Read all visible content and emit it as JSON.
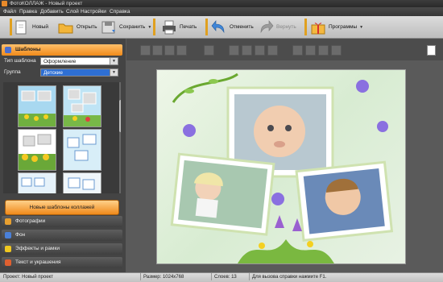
{
  "window": {
    "title": "ФотоКОЛЛАЖ - Новый проект"
  },
  "menu": [
    "Файл",
    "Правка",
    "Добавить",
    "Слой",
    "Настройки",
    "Справка"
  ],
  "toolbar": {
    "new": "Новый",
    "open": "Открыть",
    "save": "Сохранить",
    "print": "Печать",
    "undo": "Отменить",
    "redo": "Вернуть",
    "programs": "Программы"
  },
  "sidebar": {
    "templates_header": "Шаблоны",
    "template_type_label": "Тип шаблона",
    "template_type_value": "Оформление",
    "group_label": "Группа",
    "group_value": "Детские",
    "new_templates_button": "Новые шаблоны коллажей",
    "sections": [
      "Фотографии",
      "Фон",
      "Эффекты и рамки",
      "Текст и украшения"
    ]
  },
  "status": {
    "project": "Проект: Новый проект",
    "size": "Размер: 1024x768",
    "layers": "Слоев: 13",
    "help": "Для вызова справки нажмите F1."
  },
  "colors": {
    "accent": "#f08a1a",
    "selection": "#2e6fd3"
  }
}
